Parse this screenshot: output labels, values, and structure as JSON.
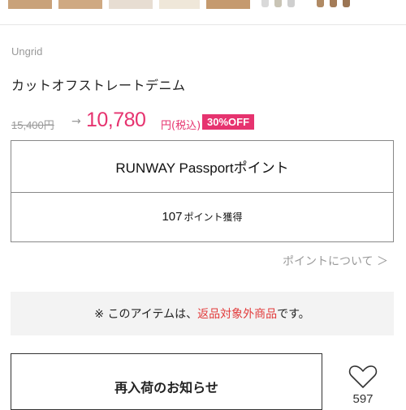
{
  "product": {
    "brand": "Ungrid",
    "title": "カットオフストレートデニム",
    "original_price": "15,400円",
    "arrow": "→",
    "sale_price": "10,780",
    "sale_unit": "円(税込)",
    "discount_badge": "30%OFF"
  },
  "passport": {
    "title": "RUNWAY Passportポイント",
    "points_value": "107",
    "points_label": "ポイント獲得"
  },
  "points_link": "ポイントについて ＞",
  "notice": {
    "prefix": "※ このアイテムは、",
    "highlight": "返品対象外商品",
    "suffix": "です。"
  },
  "restock_button": "再入荷のお知らせ",
  "favorite_count": "597",
  "colors": {
    "accent": "#e6336f",
    "notice_highlight": "#e23b3b"
  }
}
